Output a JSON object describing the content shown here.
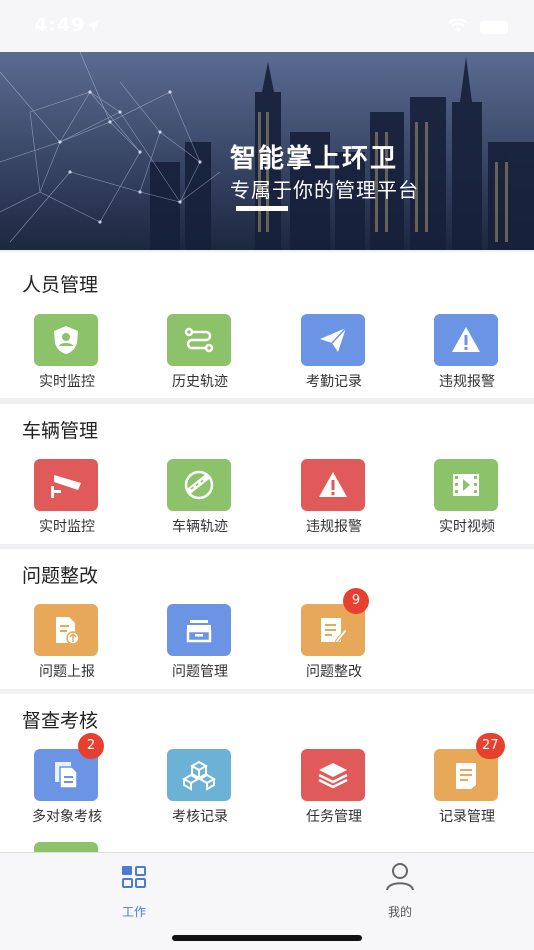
{
  "status_bar": {
    "time": "4:49"
  },
  "banner": {
    "title": "智能掌上环卫",
    "subtitle": "专属于你的管理平台"
  },
  "sections": [
    {
      "title": "人员管理",
      "items": [
        {
          "label": "实时监控",
          "icon": "shield-user-icon",
          "color": "#8cc26a"
        },
        {
          "label": "历史轨迹",
          "icon": "route-icon",
          "color": "#8cc26a"
        },
        {
          "label": "考勤记录",
          "icon": "paper-plane-icon",
          "color": "#6b95e4"
        },
        {
          "label": "违规报警",
          "icon": "warning-icon",
          "color": "#6b95e4"
        }
      ]
    },
    {
      "title": "车辆管理",
      "items": [
        {
          "label": "实时监控",
          "icon": "camera-icon",
          "color": "#e05a5a"
        },
        {
          "label": "车辆轨迹",
          "icon": "road-icon",
          "color": "#8cc26a"
        },
        {
          "label": "违规报警",
          "icon": "warning-icon",
          "color": "#e05a5a"
        },
        {
          "label": "实时视频",
          "icon": "video-icon",
          "color": "#8cc26a"
        }
      ]
    },
    {
      "title": "问题整改",
      "items": [
        {
          "label": "问题上报",
          "icon": "upload-doc-icon",
          "color": "#e8a85a"
        },
        {
          "label": "问题管理",
          "icon": "box-icon",
          "color": "#6b95e4"
        },
        {
          "label": "问题整改",
          "icon": "edit-doc-icon",
          "color": "#e8a85a",
          "badge": "9"
        }
      ]
    },
    {
      "title": "督查考核",
      "items": [
        {
          "label": "多对象考核",
          "icon": "documents-icon",
          "color": "#6b95e4",
          "badge": "2"
        },
        {
          "label": "考核记录",
          "icon": "cubes-icon",
          "color": "#6cb2d6"
        },
        {
          "label": "任务管理",
          "icon": "layers-icon",
          "color": "#e05a5a"
        },
        {
          "label": "记录管理",
          "icon": "notes-icon",
          "color": "#e8a85a",
          "badge": "27"
        }
      ]
    }
  ],
  "tabbar": {
    "work": "工作",
    "mine": "我的",
    "active_color": "#4a7bd8"
  }
}
